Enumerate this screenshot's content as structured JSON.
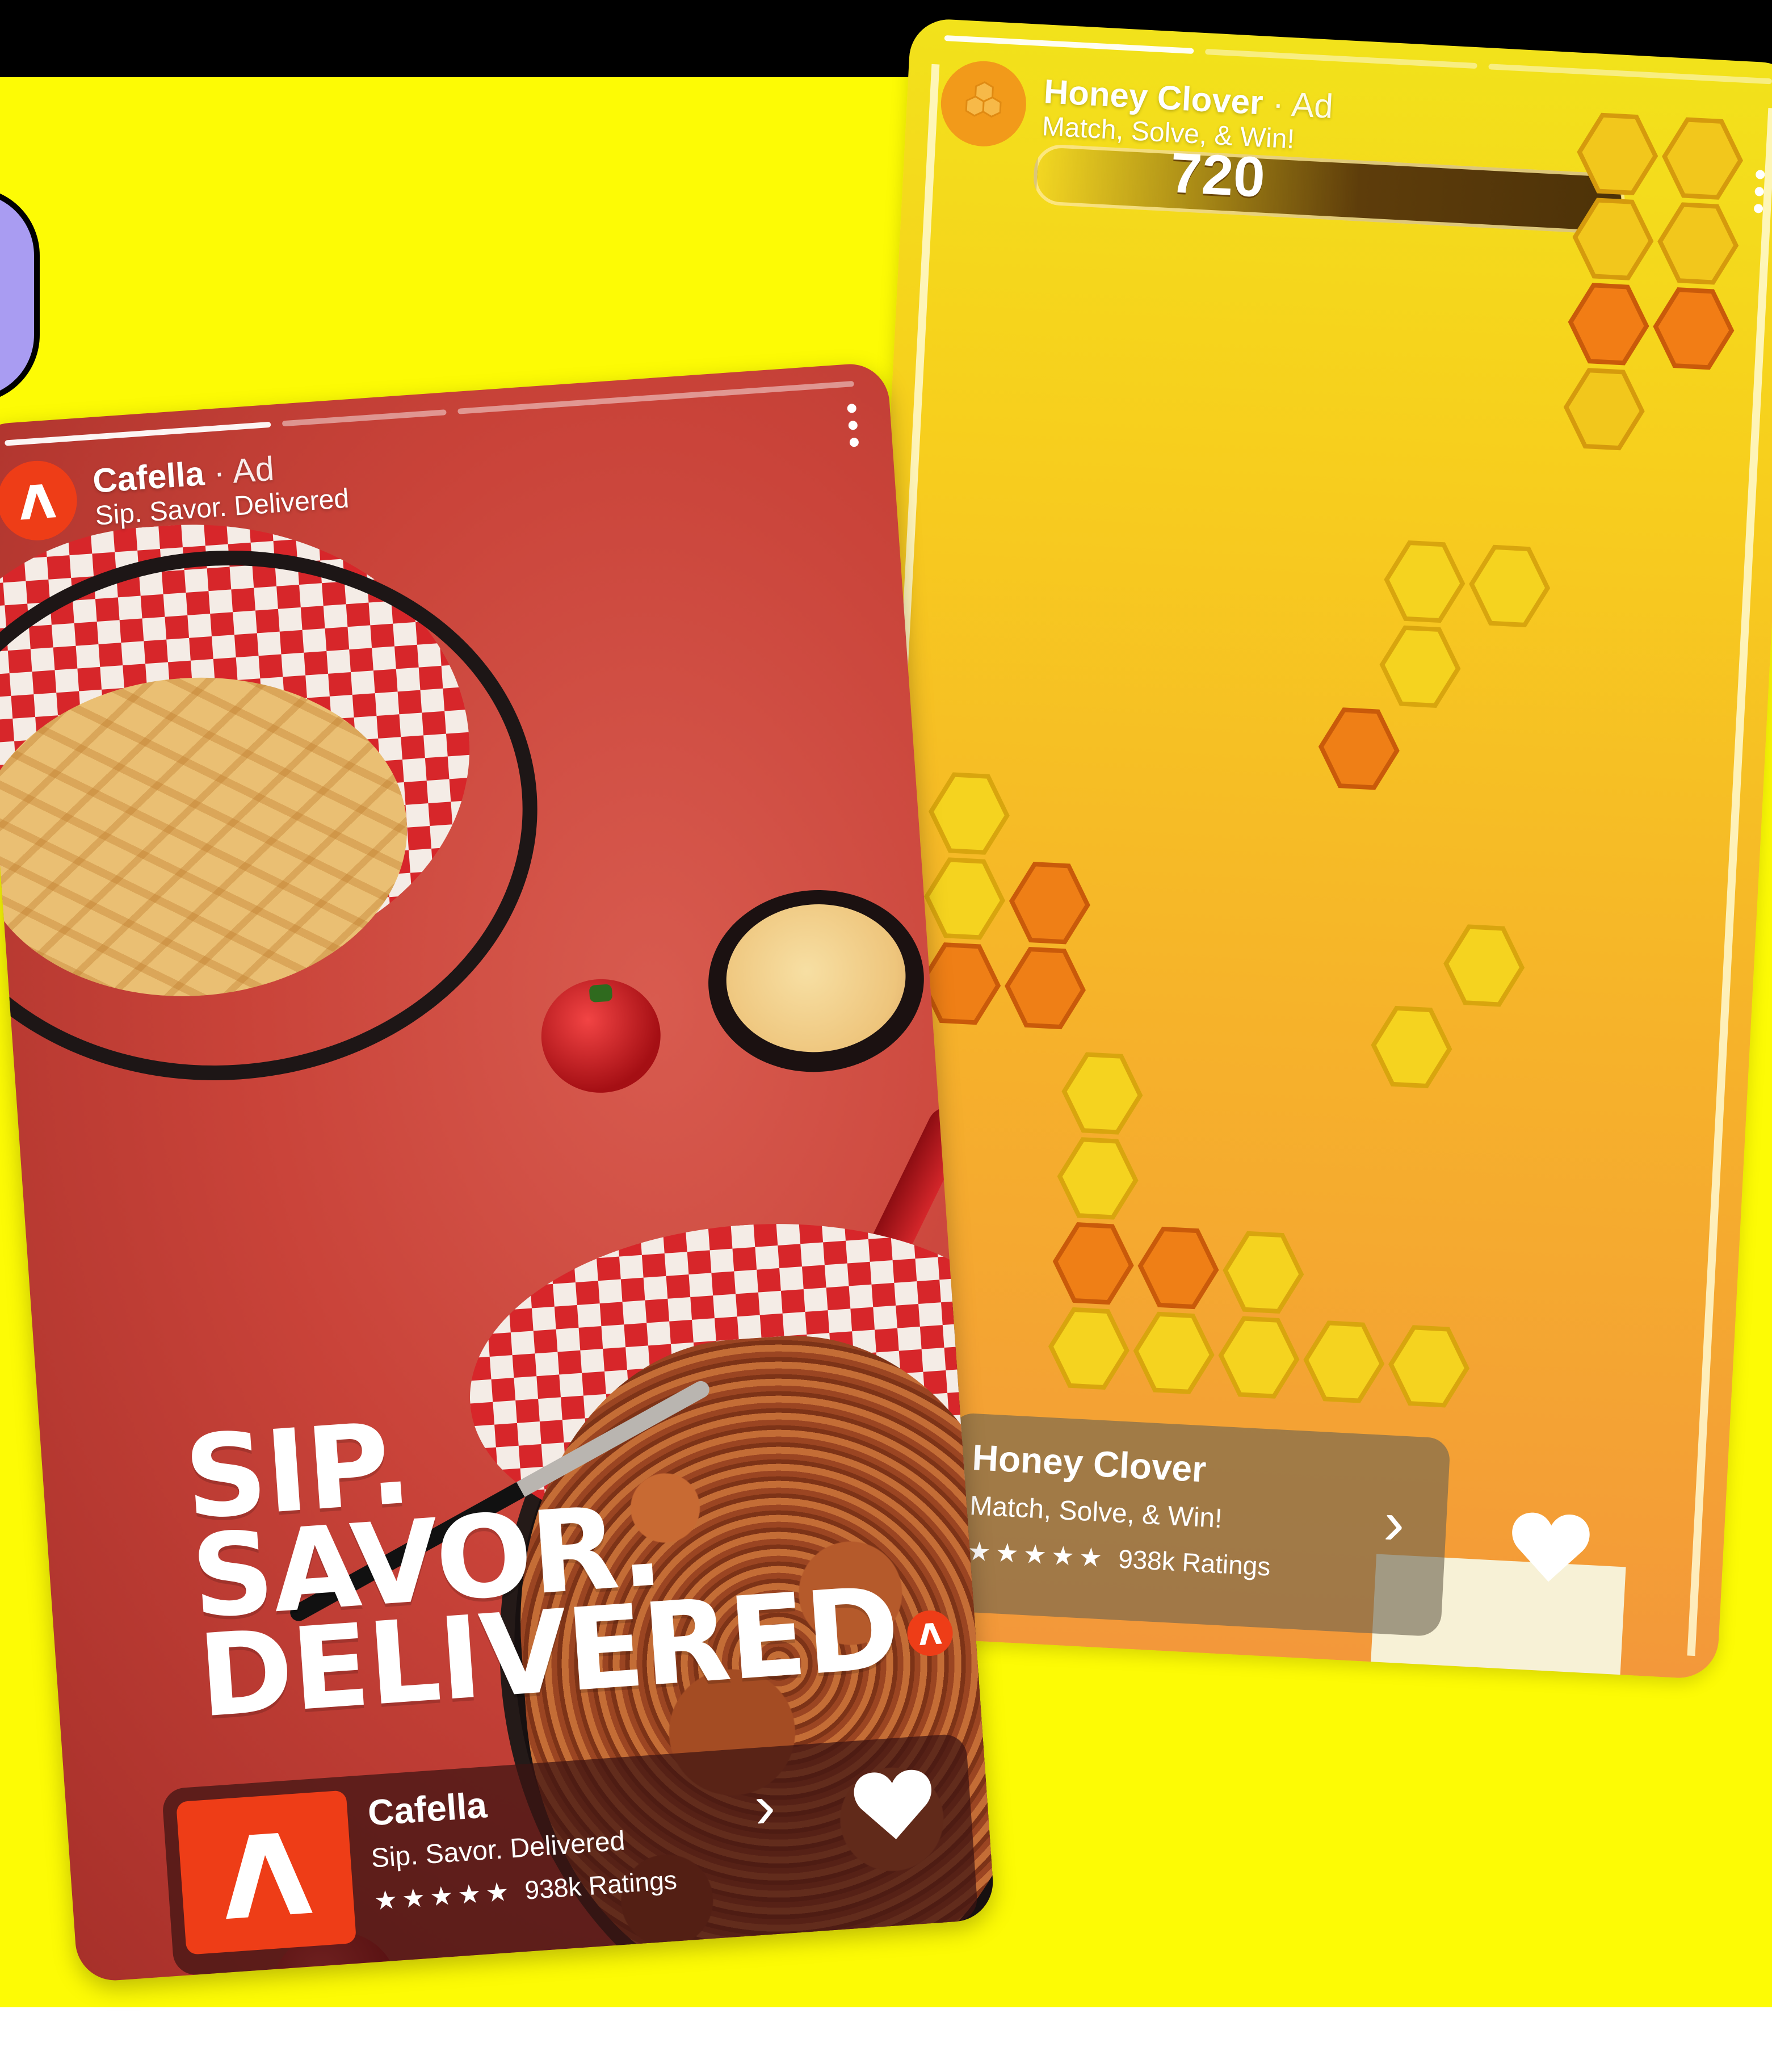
{
  "colors": {
    "background_yellow": "#fdfb05",
    "top_bar": "#000000",
    "cafella_brand": "#ee3d17",
    "honey_brand": "#f29a1a"
  },
  "honey_ad": {
    "brand": "Honey Clover",
    "ad_tag": "· Ad",
    "tagline": "Match, Solve, & Win!",
    "score": "720",
    "cta": {
      "title": "Honey Clover",
      "subtitle": "Match, Solve, & Win!",
      "stars": "★★★★★",
      "ratings": "938k Ratings"
    },
    "icons": [
      "honeycomb-logo-icon",
      "more-options-icon",
      "chevron-right-icon",
      "heart-icon"
    ]
  },
  "cafella_ad": {
    "brand": "Cafella",
    "ad_tag": "· Ad",
    "tagline": "Sip. Savor. Delivered",
    "headline": [
      "SIP.",
      "SAVOR.",
      "DELIVERED"
    ],
    "cta": {
      "title": "Cafella",
      "subtitle": "Sip. Savor. Delivered",
      "stars": "★★★★★",
      "ratings": "938k Ratings"
    },
    "icons": [
      "cafella-logo-icon",
      "more-options-icon",
      "chevron-right-icon",
      "heart-icon"
    ]
  }
}
